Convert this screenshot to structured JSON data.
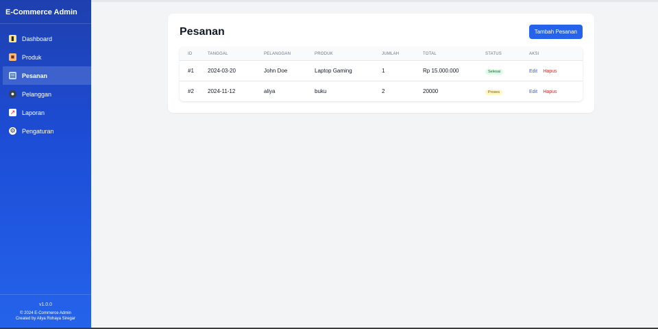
{
  "sidebar": {
    "brand": "E-Commerce Admin",
    "items": [
      {
        "label": "Dashboard",
        "icon": "dashboard-icon"
      },
      {
        "label": "Produk",
        "icon": "product-box-icon"
      },
      {
        "label": "Pesanan",
        "icon": "orders-icon",
        "active": true
      },
      {
        "label": "Pelanggan",
        "icon": "customers-icon"
      },
      {
        "label": "Laporan",
        "icon": "report-chart-icon"
      },
      {
        "label": "Pengaturan",
        "icon": "settings-gear-icon"
      }
    ],
    "version": "v1.0.0",
    "copyright": "© 2024 E-Commerce Admin",
    "credit": "Created by Aliya Rohaya Siregar"
  },
  "main": {
    "title": "Pesanan",
    "add_button": "Tambah Pesanan",
    "columns": [
      "ID",
      "Tanggal",
      "Pelanggan",
      "Produk",
      "Jumlah",
      "Total",
      "Status",
      "Aksi"
    ],
    "rows": [
      {
        "id": "#1",
        "tanggal": "2024-03-20",
        "pelanggan": "John Doe",
        "produk": "Laptop Gaming",
        "jumlah": "1",
        "total": "Rp 15.000.000",
        "status": "Selesai",
        "edit": "Edit",
        "hapus": "Hapus"
      },
      {
        "id": "#2",
        "tanggal": "2024-11-12",
        "pelanggan": "aliya",
        "produk": "buku",
        "jumlah": "2",
        "total": "20000",
        "status": "Proses",
        "edit": "Edit",
        "hapus": "Hapus"
      }
    ]
  },
  "colors": {
    "accent": "#2563eb",
    "sidebar": "#1d4ed8",
    "status_done_bg": "#dcfce7",
    "status_process_bg": "#fef9c3",
    "delete": "#dc2626"
  }
}
